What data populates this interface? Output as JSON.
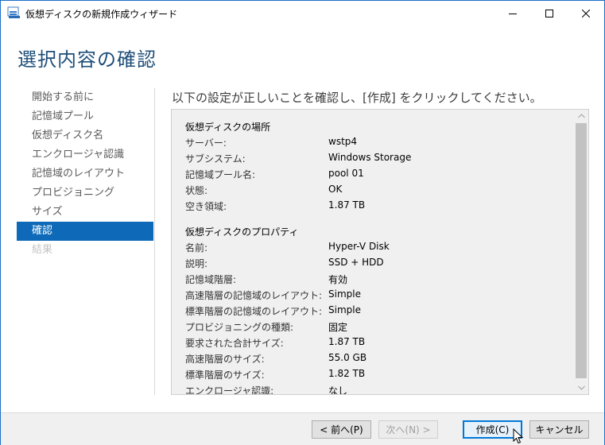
{
  "window": {
    "title": "仮想ディスクの新規作成ウィザード"
  },
  "header": {
    "title": "選択内容の確認"
  },
  "nav": {
    "items": [
      {
        "label": "開始する前に",
        "state": "normal"
      },
      {
        "label": "記憶域プール",
        "state": "normal"
      },
      {
        "label": "仮想ディスク名",
        "state": "normal"
      },
      {
        "label": "エンクロージャ認識",
        "state": "normal"
      },
      {
        "label": "記憶域のレイアウト",
        "state": "normal"
      },
      {
        "label": "プロビジョニング",
        "state": "normal"
      },
      {
        "label": "サイズ",
        "state": "normal"
      },
      {
        "label": "確認",
        "state": "active"
      },
      {
        "label": "結果",
        "state": "disabled"
      }
    ]
  },
  "main": {
    "instruction": "以下の設定が正しいことを確認し、[作成] をクリックしてください。",
    "sections": [
      {
        "title": "仮想ディスクの場所",
        "rows": [
          {
            "label": "サーバー:",
            "value": "wstp4"
          },
          {
            "label": "サブシステム:",
            "value": "Windows Storage"
          },
          {
            "label": "記憶域プール名:",
            "value": "pool 01"
          },
          {
            "label": "状態:",
            "value": "OK"
          },
          {
            "label": "空き領域:",
            "value": "1.87 TB"
          }
        ]
      },
      {
        "title": "仮想ディスクのプロパティ",
        "rows": [
          {
            "label": "名前:",
            "value": "Hyper-V Disk"
          },
          {
            "label": "説明:",
            "value": "SSD + HDD"
          },
          {
            "label": "記憶域階層:",
            "value": "有効"
          },
          {
            "label": "高速階層の記憶域のレイアウト:",
            "value": "Simple"
          },
          {
            "label": "標準階層の記憶域のレイアウト:",
            "value": "Simple"
          },
          {
            "label": "プロビジョニングの種類:",
            "value": "固定"
          },
          {
            "label": "要求された合計サイズ:",
            "value": "1.87 TB"
          },
          {
            "label": "高速階層のサイズ:",
            "value": "55.0 GB"
          },
          {
            "label": "標準階層のサイズ:",
            "value": "1.82 TB"
          },
          {
            "label": "エンクロージャ認識:",
            "value": "なし"
          }
        ]
      }
    ]
  },
  "footer": {
    "prev_label": "< 前へ(P)",
    "next_label": "次へ(N) >",
    "create_label": "作成(C)",
    "cancel_label": "キャンセル"
  },
  "colors": {
    "accent": "#0e6ab8",
    "title_blue": "#1e4e79",
    "window_border": "#1a6fc8"
  }
}
